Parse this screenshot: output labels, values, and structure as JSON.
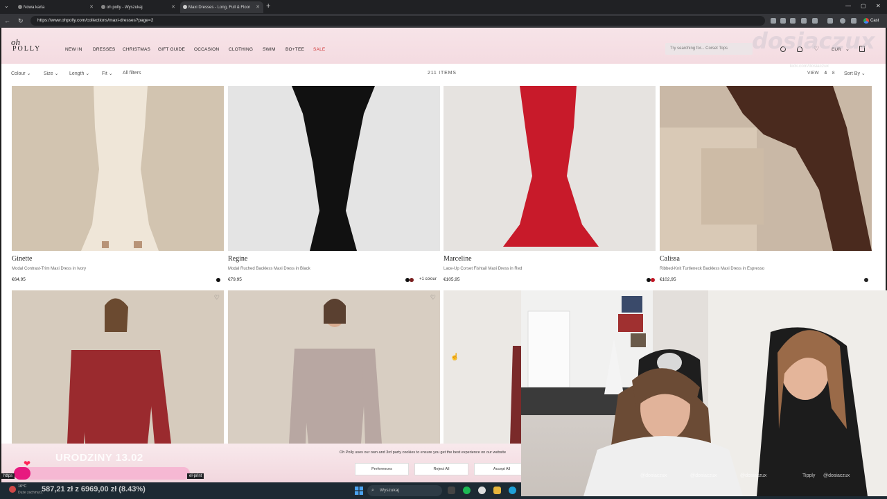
{
  "browser": {
    "tabs": [
      {
        "title": "Nowa karta",
        "active": false
      },
      {
        "title": "oh polly - Wyszukaj",
        "active": false
      },
      {
        "title": "Maxi Dresses - Long, Full & Floor",
        "active": true
      }
    ],
    "url": "https://www.ohpolly.com/collections/maxi-dresses?page=2",
    "cast_label": "Cast"
  },
  "site": {
    "logo_line1": "oh",
    "logo_line2": "POLLY",
    "nav": [
      "NEW IN",
      "DRESSES",
      "CHRISTMAS",
      "GIFT GUIDE",
      "OCCASION",
      "CLOTHING",
      "SWIM",
      "BO+TEE",
      "SALE"
    ],
    "search_placeholder": "Try searching for... Corset Tops",
    "currency": "EUR"
  },
  "filters": {
    "items": [
      "Colour",
      "Size",
      "Length",
      "Fit"
    ],
    "all_filters": "All filters",
    "count": "211 ITEMS",
    "view_label": "VIEW",
    "view_options": [
      "4",
      "8"
    ],
    "sort_label": "Sort By"
  },
  "products": [
    {
      "name": "Ginette",
      "desc": "Modal Contrast-Trim Maxi Dress in Ivory",
      "price": "€64,95",
      "extra": "",
      "swatches": [
        "#111111"
      ],
      "dress_color": "#efe6d8",
      "bg": "#d2c4b0"
    },
    {
      "name": "Regine",
      "desc": "Modal Ruched Backless Maxi Dress in Black",
      "price": "€79,95",
      "extra": "+1 colour",
      "swatches": [
        "#111111",
        "#7a1f1f"
      ],
      "dress_color": "#111111",
      "bg": "#e4e4e4"
    },
    {
      "name": "Marceline",
      "desc": "Lace-Up Corset Fishtail Maxi Dress in Red",
      "price": "€105,95",
      "extra": "",
      "swatches": [
        "#111111",
        "#c01624"
      ],
      "dress_color": "#c81a2a",
      "bg": "#e6e3e0"
    },
    {
      "name": "Calissa",
      "desc": "Ribbed-Knit Turtleneck Backless Maxi Dress in Espresso",
      "price": "€102,95",
      "extra": "",
      "swatches": [
        "#222222"
      ],
      "dress_color": "#4a2a1e",
      "bg": "#c9b8a6"
    },
    {
      "name": "",
      "desc": "",
      "price": "",
      "extra": "",
      "swatches": [],
      "dress_color": "#9a2a2e",
      "bg": "#d6cbbd"
    },
    {
      "name": "",
      "desc": "",
      "price": "",
      "extra": "",
      "swatches": [],
      "dress_color": "#b8a7a2",
      "bg": "#d8cec2"
    },
    {
      "name": "",
      "desc": "",
      "price": "",
      "extra": "",
      "swatches": [],
      "dress_color": "#7a2a2a",
      "bg": "#ebe8e4"
    }
  ],
  "cookie": {
    "text": "Oh Polly uses our own and 3rd party cookies to ensure you get the best experience on our website",
    "preferences": "Preferences",
    "reject": "Reject All",
    "accept": "Accept All"
  },
  "overlay": {
    "birthday": "URODZINY 13.02",
    "goal": "587,21 zł z 6969,00 zł (8.43%)",
    "goal_fraction": 0.0843,
    "tooltip_left": "https",
    "tooltip_right": "el-print",
    "watermark": "dosiaczux",
    "kick_tag": "kick.com/dosiaczux"
  },
  "webcam": {
    "socials": [
      "@dosiaczux",
      "@dosiaczux",
      "@dosiaczux",
      "Tipply",
      "@dosiaczux"
    ]
  },
  "taskbar": {
    "temp": "10°C",
    "weather": "Duże zachmurz.",
    "search": "Wyszukaj"
  }
}
